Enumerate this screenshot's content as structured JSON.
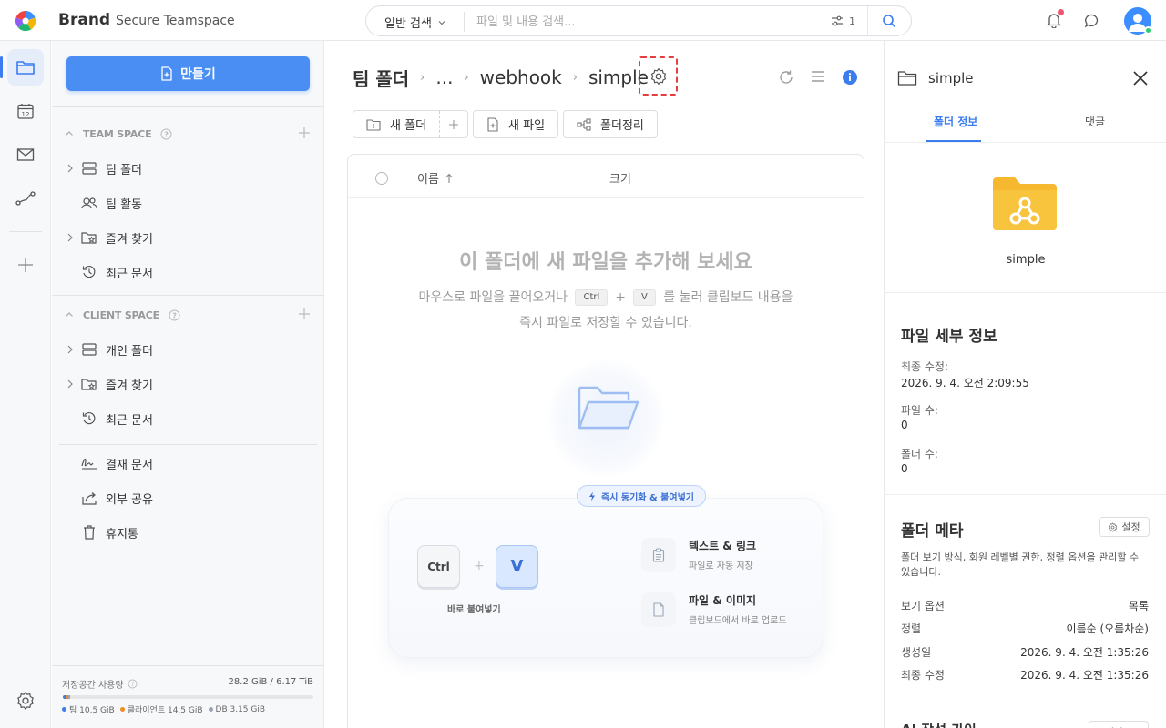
{
  "app": {
    "brand": "Brand",
    "subtitle": "Secure Teamspace"
  },
  "search": {
    "type_label": "일반 검색",
    "placeholder": "파일 및 내용 검색...",
    "filter_count": "1"
  },
  "sidebar": {
    "create_label": "만들기",
    "team_section": "TEAM SPACE",
    "team_items": [
      {
        "label": "팀 폴더",
        "icon": "server-icon"
      },
      {
        "label": "팀 활동",
        "icon": "users-icon"
      },
      {
        "label": "즐겨 찾기",
        "icon": "folder-star-icon"
      },
      {
        "label": "최근 문서",
        "icon": "history-icon"
      }
    ],
    "client_section": "CLIENT SPACE",
    "client_items": [
      {
        "label": "개인 폴더",
        "icon": "server-icon"
      },
      {
        "label": "즐겨 찾기",
        "icon": "folder-star-icon"
      },
      {
        "label": "최근 문서",
        "icon": "history-icon"
      }
    ],
    "extra_items": [
      {
        "label": "결재 문서",
        "icon": "signature-icon"
      },
      {
        "label": "외부 공유",
        "icon": "share-icon"
      },
      {
        "label": "휴지통",
        "icon": "trash-icon"
      }
    ],
    "storage": {
      "label": "저장공간 사용량",
      "value": "28.2 GiB / 6.17 TiB",
      "team": "팀 10.5 GiB",
      "client": "클라이언트 14.5 GiB",
      "db": "DB 3.15 GiB",
      "team_fraction": 0.0017,
      "client_fraction": 0.0023,
      "db_fraction": 0.0005,
      "colors": {
        "team": "#3c7cf0",
        "client": "#f08a24",
        "db": "#9aa3b0"
      }
    }
  },
  "breadcrumb": {
    "root": "팀 폴더",
    "ellipsis": "...",
    "parent": "webhook",
    "current": "simple"
  },
  "toolbar": {
    "new_folder": "새 폴더",
    "new_file": "새 파일",
    "organize": "폴더정리"
  },
  "table": {
    "col_name": "이름",
    "col_size": "크기"
  },
  "empty": {
    "title": "이 폴더에 새 파일을 추가해 보세요",
    "desc_pre": "마우스로 파일을 끌어오거나",
    "key_ctrl": "Ctrl",
    "plus": "+",
    "key_v": "V",
    "desc_post": "를 눌러 클립보드 내용을 즉시 파일로 저장할 수 있습니다.",
    "badge": "즉시 동기화 & 붙여넣기",
    "paste_caption": "바로 붙여넣기",
    "feature1_title": "텍스트 & 링크",
    "feature1_desc": "파일로 자동 저장",
    "feature2_title": "파일 & 이미지",
    "feature2_desc": "클립보드에서 바로 업로드"
  },
  "right_panel": {
    "title": "simple",
    "tab_info": "폴더 정보",
    "tab_comments": "댓글",
    "folder_name": "simple",
    "details_heading": "파일 세부 정보",
    "modified_label": "최종 수정:",
    "modified_value": "2026. 9. 4. 오전 2:09:55",
    "file_count_label": "파일 수:",
    "file_count_value": "0",
    "folder_count_label": "폴더 수:",
    "folder_count_value": "0",
    "meta_heading": "폴더 메타",
    "meta_button": "설정",
    "meta_desc": "폴더 보기 방식, 회원 레벨별 권한, 정렬 옵션을 관리할 수 있습니다.",
    "meta_rows": [
      {
        "key": "보기 옵션",
        "value": "목록"
      },
      {
        "key": "정렬",
        "value": "이름순 (오름차순)"
      },
      {
        "key": "생성일",
        "value": "2026. 9. 4. 오전 1:35:26"
      },
      {
        "key": "최종 수정",
        "value": "2026. 9. 4. 오전 1:35:26"
      }
    ],
    "ai_heading": "AI 작성 가이",
    "ai_button": "가이드"
  },
  "colors": {
    "accent": "#3b7cef",
    "create_button": "#4a8ef3",
    "folder_yellow": "#f7c33a",
    "highlight": "#e53e3e"
  }
}
